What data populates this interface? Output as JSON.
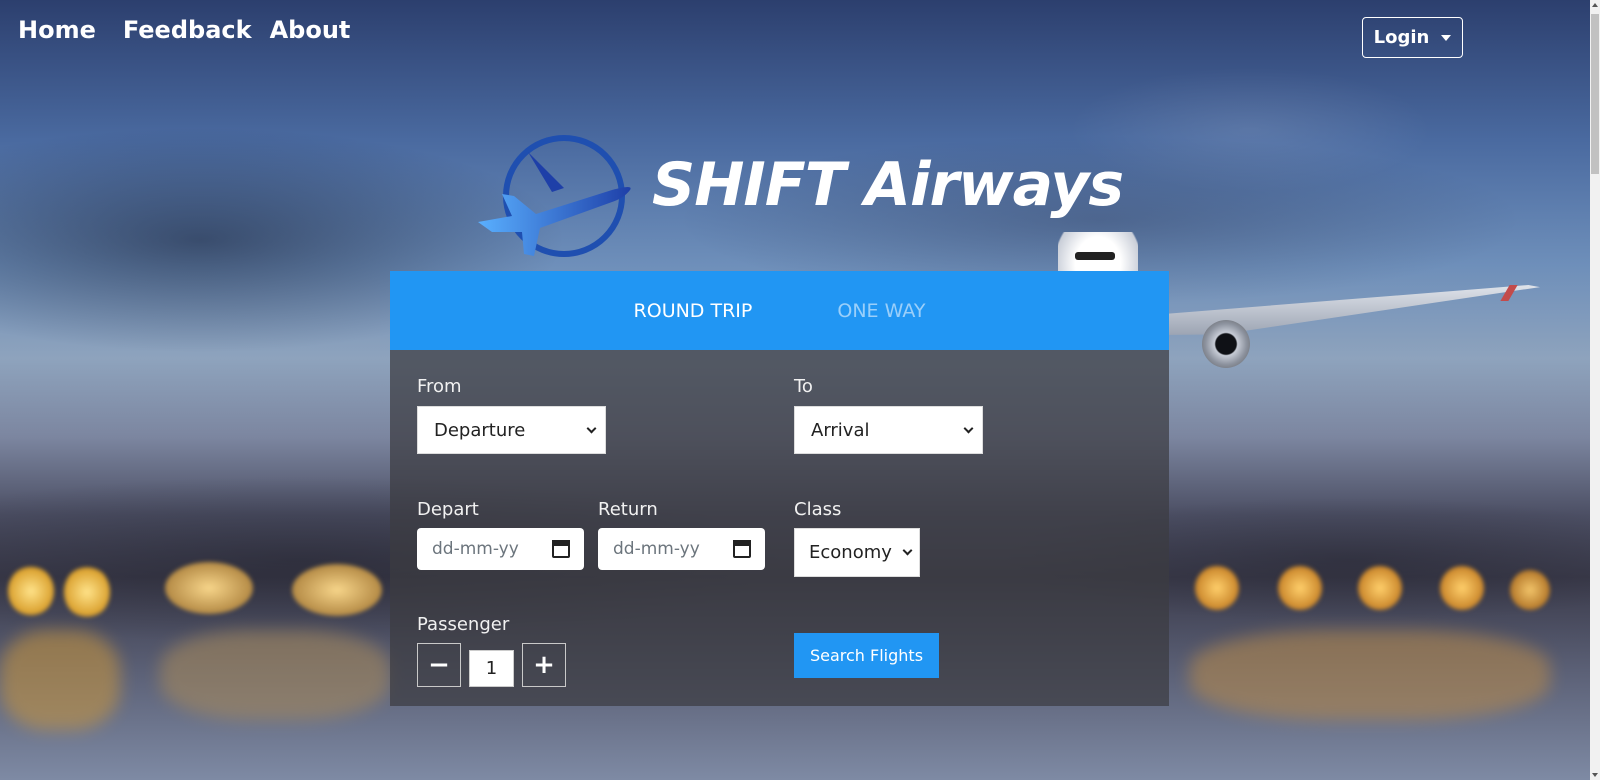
{
  "nav": {
    "home": "Home",
    "feedback": "Feedback",
    "about": "About",
    "login": "Login"
  },
  "brand": {
    "name": "SHIFT Airways",
    "logo_icon": "airplane-circle-logo"
  },
  "tabs": [
    {
      "label": "ROUND TRIP",
      "active": true
    },
    {
      "label": "ONE WAY",
      "active": false
    }
  ],
  "form": {
    "from_label": "From",
    "from_value": "Departure",
    "to_label": "To",
    "to_value": "Arrival",
    "depart_label": "Depart",
    "depart_placeholder": "dd-mm-yy",
    "return_label": "Return",
    "return_placeholder": "dd-mm-yy",
    "class_label": "Class",
    "class_value": "Economy",
    "passenger_label": "Passenger",
    "passenger_value": "1",
    "minus": "−",
    "plus": "+",
    "search_button": "Search Flights"
  },
  "colors": {
    "accent": "#2196f3",
    "panel": "rgba(60,60,65,0.72)",
    "logo_blue": "#1f4fb0"
  }
}
